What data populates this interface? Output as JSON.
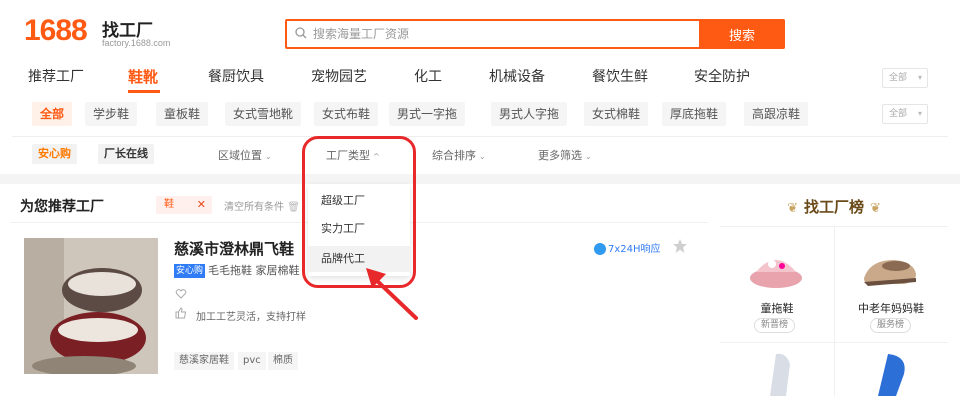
{
  "header": {
    "logo_number": "1688",
    "logo_title": "找工厂",
    "logo_subtitle": "factory.1688.com",
    "search_placeholder": "搜索海量工厂资源",
    "search_button": "搜索"
  },
  "categories": {
    "items": [
      "推荐工厂",
      "鞋靴",
      "餐厨饮具",
      "宠物园艺",
      "化工",
      "机械设备",
      "餐饮生鲜",
      "安全防护"
    ],
    "active": "鞋靴",
    "all_select": "全部"
  },
  "subcategories": {
    "items": [
      "全部",
      "学步鞋",
      "童板鞋",
      "女式雪地靴",
      "女式布鞋",
      "男式一字拖",
      "男式人字拖",
      "女式棉鞋",
      "厚底拖鞋",
      "高跟凉鞋"
    ],
    "active": "全部",
    "all_select": "全部"
  },
  "filters": {
    "tag_anxin": "安心购",
    "tag_online": "厂长在线",
    "region": "区域位置",
    "factory_type": "工厂类型",
    "sort": "综合排序",
    "more": "更多筛选"
  },
  "dropdown": {
    "items": [
      "超级工厂",
      "实力工厂",
      "品牌代工"
    ],
    "hovered": "品牌代工"
  },
  "recommend": {
    "title": "为您推荐工厂",
    "filter_tag": "鞋",
    "clear_all": "清空所有条件",
    "factory": {
      "name": "慈溪市澄林鼎飞鞋",
      "badge": "安心购",
      "categories": "毛毛拖鞋 家居棉鞋",
      "process": "加工工艺灵活，支持打样",
      "reply": "7x24H响应",
      "tags": [
        "慈溪家居鞋",
        "pvc",
        "棉质"
      ]
    }
  },
  "ranking": {
    "title": "找工厂榜",
    "items": [
      {
        "name": "童拖鞋",
        "tag": "新晋榜"
      },
      {
        "name": "中老年妈妈鞋",
        "tag": "服务榜"
      }
    ]
  },
  "colors": {
    "brand": "#ff5a14",
    "annotation": "#e8292b",
    "badge_blue": "#2f7cf6"
  }
}
